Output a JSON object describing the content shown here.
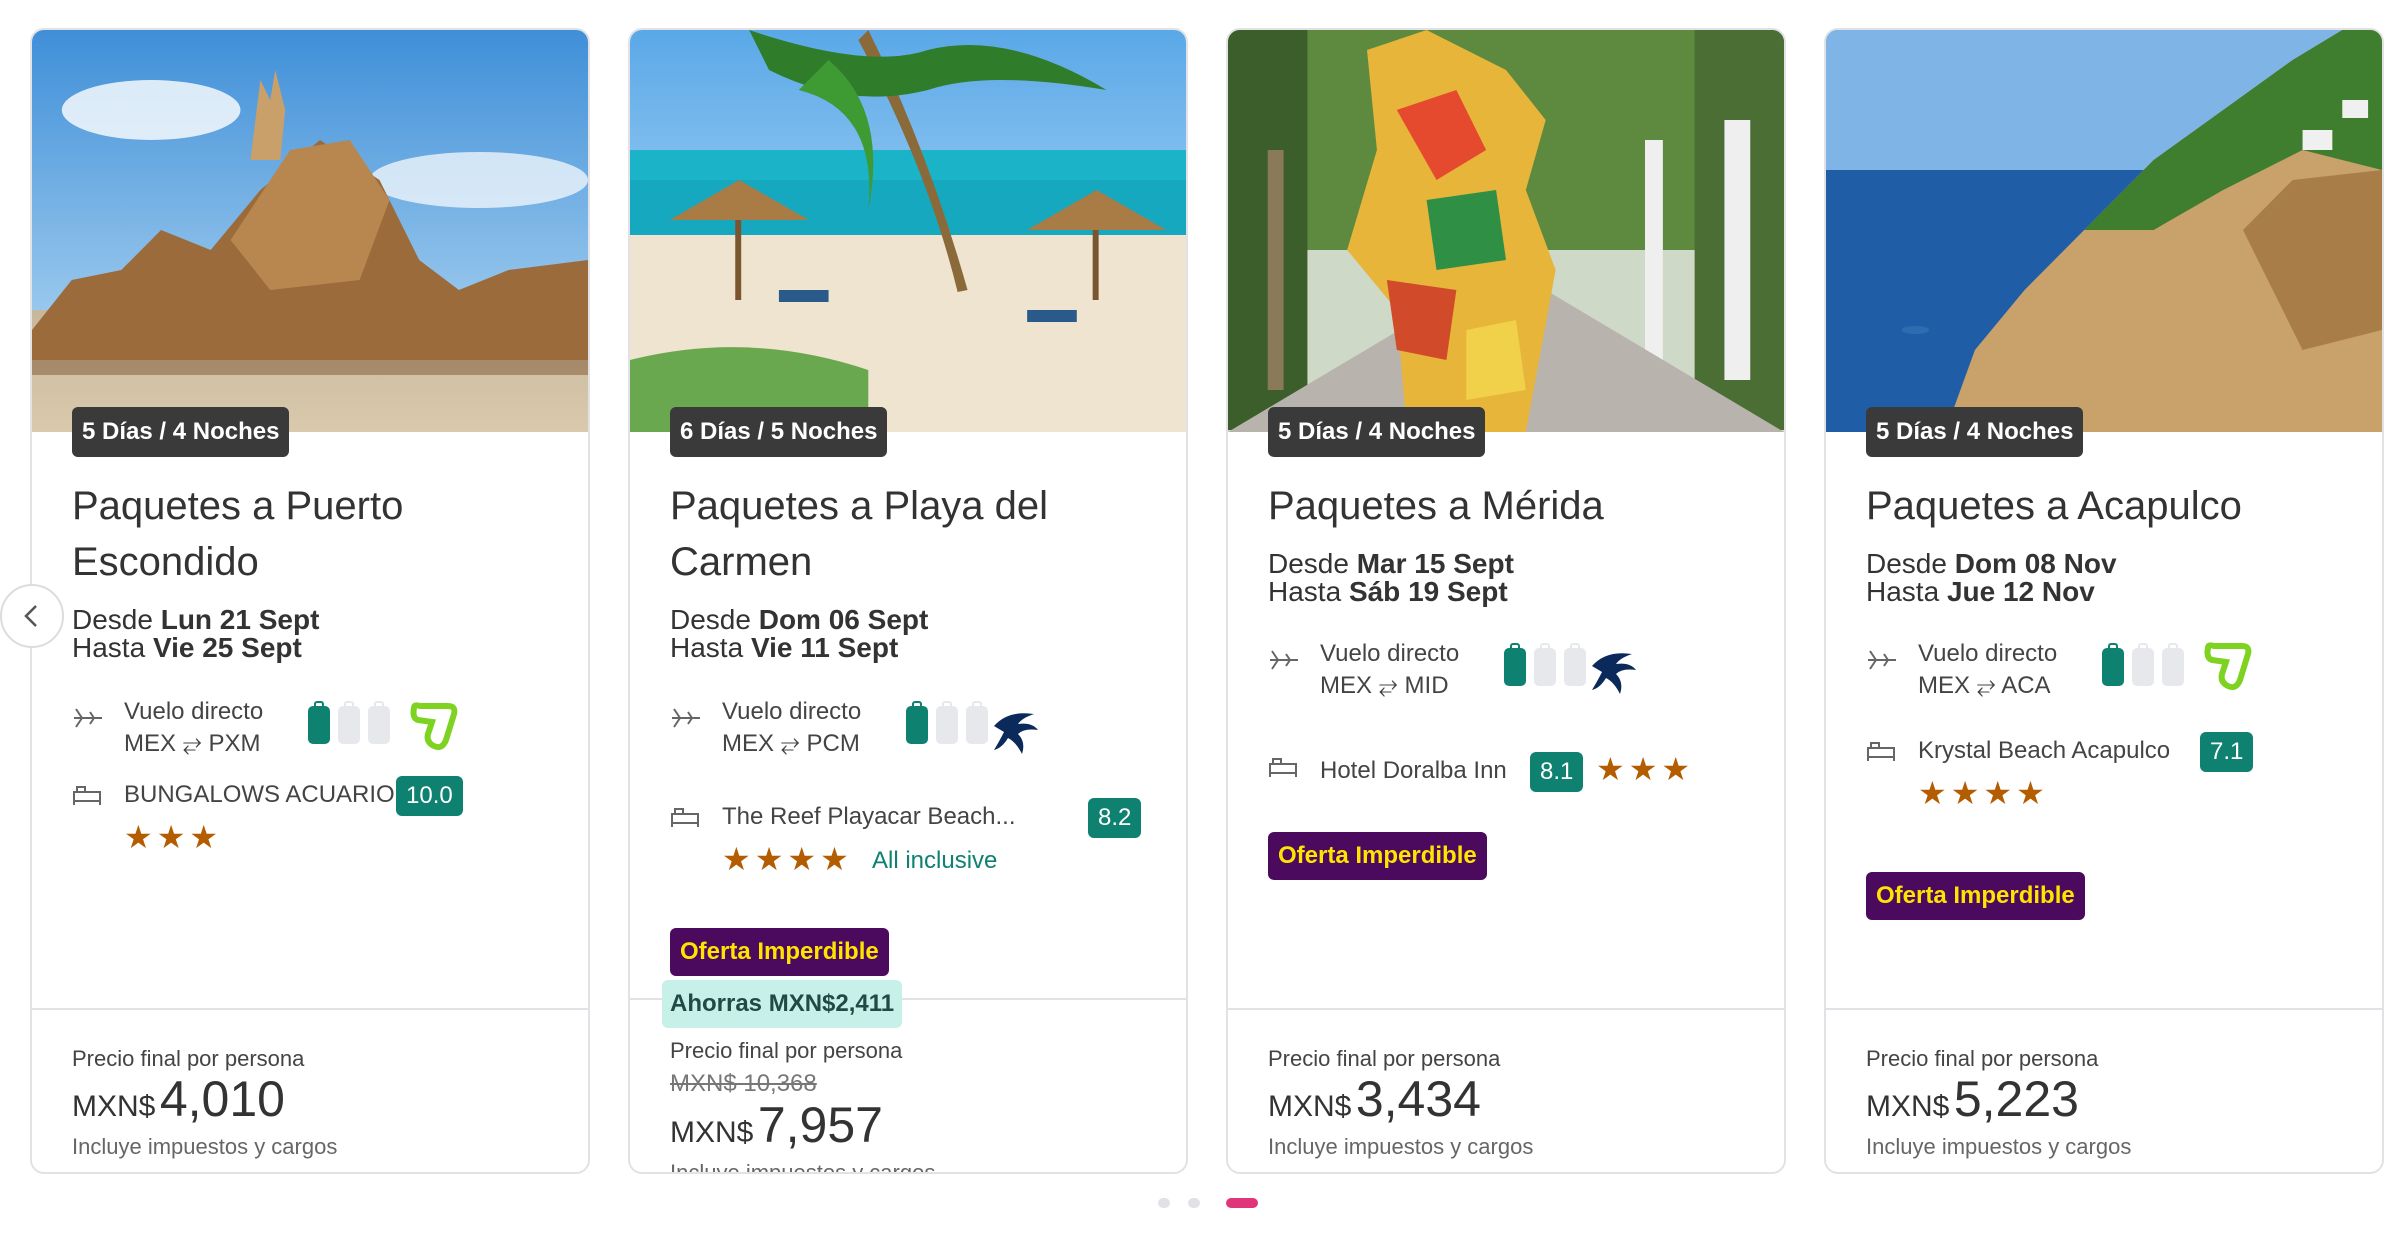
{
  "carousel": {
    "prev_icon": "chevron-left-icon",
    "dots": [
      {
        "active": false
      },
      {
        "active": false
      },
      {
        "active": true
      }
    ],
    "colors": {
      "dot_active": "#e0357a",
      "dot_inactive": "#e2e2e6"
    }
  },
  "colors": {
    "brand_green": "#0e8170",
    "oferta_bg": "#4b0a5e",
    "oferta_text": "#ffe400",
    "stars": "#b35c00",
    "ahorras_bg": "#c6f0e8"
  },
  "cards": [
    {
      "duration": "5 Días / 4 Noches",
      "title": "Paquetes a Puerto Escondido",
      "desde_label": "Desde",
      "desde_date": "Lun 21 Sept",
      "hasta_label": "Hasta",
      "hasta_date": "Vie 25 Sept",
      "flight_type": "Vuelo directo",
      "route": "MEX ⥂ PXM",
      "airline_icon": "volaris-logo-icon",
      "hotel": "BUNGALOWS ACUARIO",
      "score": "10.0",
      "stars": "★★★",
      "price_label": "Precio final por persona",
      "currency": "MXN$",
      "price": "4,010",
      "includes": "Incluye impuestos y cargos"
    },
    {
      "duration": "6 Días / 5 Noches",
      "title": "Paquetes a Playa del Carmen",
      "desde_label": "Desde",
      "desde_date": "Dom 06 Sept",
      "hasta_label": "Hasta",
      "hasta_date": "Vie 11 Sept",
      "flight_type": "Vuelo directo",
      "route": "MEX ⥂ PCM",
      "airline_icon": "aeromexico-logo-icon",
      "hotel": "The Reef Playacar Beach...",
      "score": "8.2",
      "stars": "★★★★",
      "extra": "All inclusive",
      "oferta": "Oferta Imperdible",
      "ahorras": "Ahorras MXN$2,411",
      "price_label": "Precio final por persona",
      "old_price": "MXN$ 10,368",
      "currency": "MXN$",
      "price": "7,957",
      "includes": "Incluye impuestos y cargos"
    },
    {
      "duration": "5 Días / 4 Noches",
      "title": "Paquetes a Mérida",
      "desde_label": "Desde",
      "desde_date": "Mar 15 Sept",
      "hasta_label": "Hasta",
      "hasta_date": "Sáb 19 Sept",
      "flight_type": "Vuelo directo",
      "route": "MEX ⥂ MID",
      "airline_icon": "aeromexico-logo-icon",
      "hotel": "Hotel Doralba Inn",
      "score": "8.1",
      "stars": "★★★",
      "oferta": "Oferta Imperdible",
      "price_label": "Precio final por persona",
      "currency": "MXN$",
      "price": "3,434",
      "includes": "Incluye impuestos y cargos"
    },
    {
      "duration": "5 Días / 4 Noches",
      "title": "Paquetes a Acapulco",
      "desde_label": "Desde",
      "desde_date": "Dom 08 Nov",
      "hasta_label": "Hasta",
      "hasta_date": "Jue 12 Nov",
      "flight_type": "Vuelo directo",
      "route": "MEX ⥂ ACA",
      "airline_icon": "volaris-logo-icon",
      "hotel": "Krystal Beach Acapulco",
      "score": "7.1",
      "stars": "★★★★",
      "oferta": "Oferta Imperdible",
      "price_label": "Precio final por persona",
      "currency": "MXN$",
      "price": "5,223",
      "includes": "Incluye impuestos y cargos"
    }
  ]
}
